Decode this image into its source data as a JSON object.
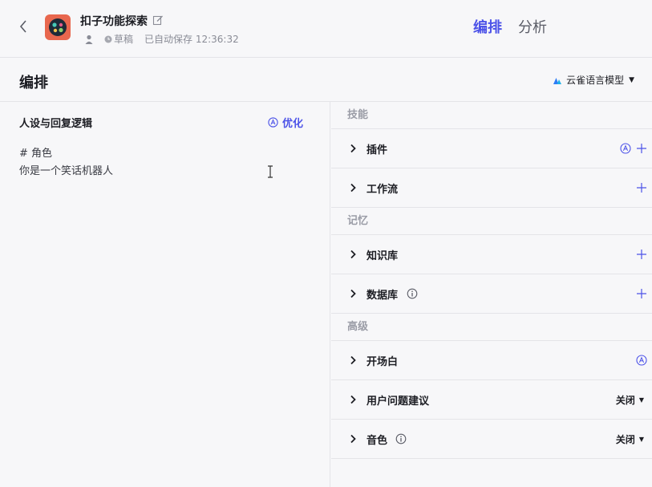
{
  "header": {
    "title": "扣子功能探索",
    "status": "草稿",
    "autosave": "已自动保存 12:36:32",
    "tabs": [
      {
        "label": "编排",
        "active": true
      },
      {
        "label": "分析",
        "active": false
      }
    ]
  },
  "subheader": {
    "title": "编排",
    "model": "云雀语言模型"
  },
  "prompt_panel": {
    "title": "人设与回复逻辑",
    "optimize_label": "优化",
    "lines": [
      "# 角色",
      "你是一个笑话机器人"
    ]
  },
  "skills": {
    "groups": [
      {
        "label": "技能"
      },
      {
        "label": "记忆"
      },
      {
        "label": "高级"
      }
    ],
    "rows": [
      {
        "label": "插件"
      },
      {
        "label": "工作流"
      },
      {
        "label": "知识库"
      },
      {
        "label": "数据库"
      },
      {
        "label": "开场白"
      },
      {
        "label": "用户问题建议",
        "value": "关闭"
      },
      {
        "label": "音色",
        "value": "关闭"
      }
    ]
  },
  "colors": {
    "accent": "#4d53e8",
    "avatar": "#e8674e"
  }
}
